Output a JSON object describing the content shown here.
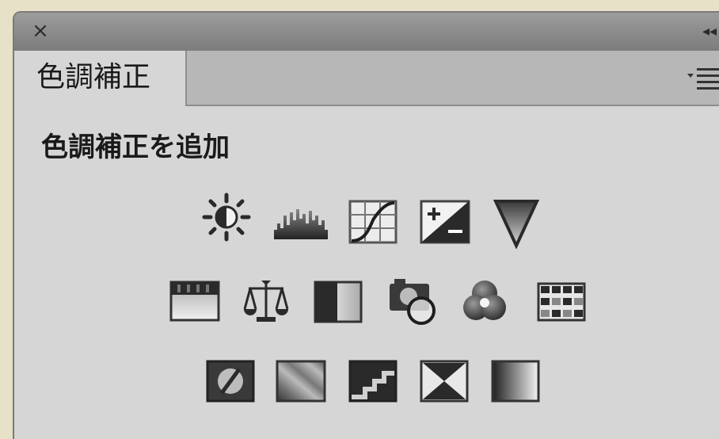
{
  "panel": {
    "close_glyph": "×",
    "collapse_glyph": "◂◂",
    "tab_label": "色調補正",
    "heading": "色調補正を追加"
  },
  "icons": {
    "row1": [
      "brightness-contrast-icon",
      "levels-icon",
      "curves-icon",
      "exposure-icon",
      "vibrance-icon"
    ],
    "row2": [
      "hue-saturation-icon",
      "color-balance-icon",
      "black-white-icon",
      "photo-filter-icon",
      "channel-mixer-icon",
      "color-lookup-icon"
    ],
    "row3": [
      "invert-icon",
      "posterize-icon",
      "threshold-icon",
      "selective-color-icon",
      "gradient-map-icon"
    ]
  },
  "colors": {
    "panel_bg": "#d6d6d6",
    "titlebar": "#8a8a8a",
    "icon_dark": "#2a2a2a"
  }
}
